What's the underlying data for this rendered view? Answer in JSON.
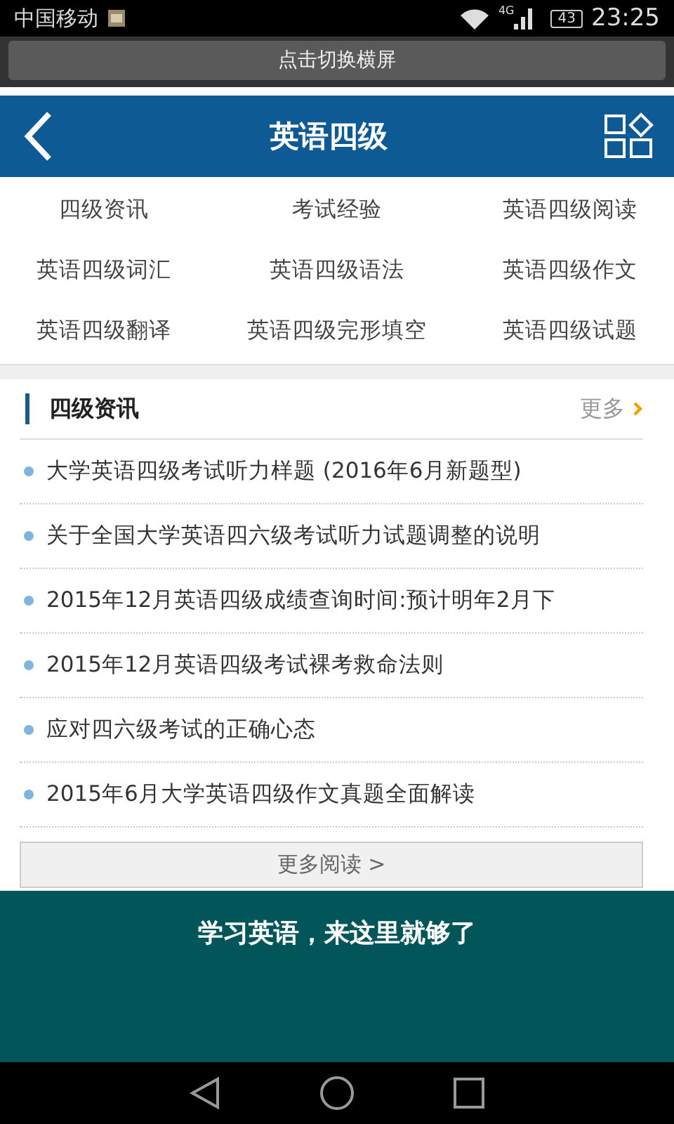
{
  "status_bar": {
    "carrier": "中国移动",
    "network": "4G",
    "battery": "43",
    "time": "23:25"
  },
  "rotate_banner": {
    "label": "点击切换横屏"
  },
  "header": {
    "title": "英语四级"
  },
  "categories": [
    {
      "label": "四级资讯"
    },
    {
      "label": "考试经验"
    },
    {
      "label": "英语四级阅读"
    },
    {
      "label": "英语四级词汇"
    },
    {
      "label": "英语四级语法"
    },
    {
      "label": "英语四级作文"
    },
    {
      "label": "英语四级翻译"
    },
    {
      "label": "英语四级完形填空"
    },
    {
      "label": "英语四级试题"
    }
  ],
  "section": {
    "title": "四级资讯",
    "more": "更多",
    "articles": [
      "大学英语四级考试听力样题 (2016年6月新题型)",
      "关于全国大学英语四六级考试听力试题调整的说明",
      "2015年12月英语四级成绩查询时间:预计明年2月下",
      "2015年12月英语四级考试裸考救命法则",
      "应对四六级考试的正确心态",
      "2015年6月大学英语四级作文真题全面解读"
    ],
    "more_reading": "更多阅读 >"
  },
  "overlay": {
    "message": "学习英语，来这里就够了"
  }
}
